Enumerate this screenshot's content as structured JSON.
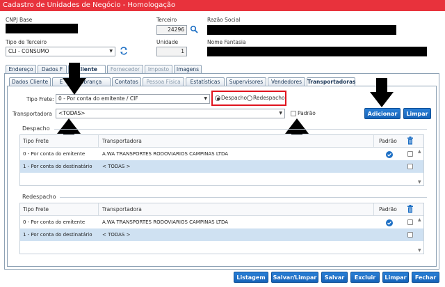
{
  "window": {
    "title": "Cadastro de Unidades de Negócio  - Homologação"
  },
  "header": {
    "cnpj_label": "CNPJ Base",
    "terceiro_label": "Terceiro",
    "terceiro_value": "24296",
    "razao_label": "Razão Social",
    "tipo_terceiro_label": "Tipo de Terceiro",
    "tipo_terceiro_value": "CLI - CONSUMO",
    "unidade_label": "Unidade",
    "unidade_value": "1",
    "fantasia_label": "Nome Fantasia"
  },
  "main_tabs": [
    {
      "label": "Endereço",
      "state": "normal"
    },
    {
      "label": "Dados F",
      "state": "normal"
    },
    {
      "label": "Cliente",
      "state": "active"
    },
    {
      "label": "Fornecedor",
      "state": "disabled"
    },
    {
      "label": "Imposto",
      "state": "disabled"
    },
    {
      "label": "Imagens",
      "state": "normal"
    }
  ],
  "sub_tabs": [
    {
      "label": "Dados Cliente",
      "state": "normal"
    },
    {
      "label": "E",
      "state": "normal"
    },
    {
      "label": "obrança",
      "state": "normal"
    },
    {
      "label": "Contatos",
      "state": "normal"
    },
    {
      "label": "Pessoa Física",
      "state": "disabled"
    },
    {
      "label": "Estatísticas",
      "state": "normal"
    },
    {
      "label": "Supervisores",
      "state": "normal"
    },
    {
      "label": "Vendedores",
      "state": "normal"
    },
    {
      "label": "Transportadoras",
      "state": "active"
    }
  ],
  "form": {
    "tipo_frete_label": "Tipo Frete:",
    "tipo_frete_value": "0 - Por conta do emitente / CIF",
    "radio_despacho": "Despacho",
    "radio_redespacho": "Redespacho",
    "radio_selected": "Despacho",
    "transportadora_label": "Transportadora",
    "transportadora_value": "<TODAS>",
    "padrao_label": "Padrão",
    "adicionar": "Adicionar",
    "limpar": "Limpar"
  },
  "despacho": {
    "title": "Despacho",
    "columns": {
      "tipo": "Tipo Frete",
      "transportadora": "Transportadora",
      "padrao": "Padrão"
    },
    "rows": [
      {
        "tipo": "0 - Por conta do emitente",
        "transportadora": "A.WA TRANSPORTES RODOVIARIOS CAMPINAS LTDA",
        "padrao": true,
        "selected": false
      },
      {
        "tipo": "1 - Por conta do destinatário",
        "transportadora": "< TODAS >",
        "padrao": false,
        "selected": true
      }
    ]
  },
  "redespacho": {
    "title": "Redespacho",
    "columns": {
      "tipo": "Tipo Frete",
      "transportadora": "Transportadora",
      "padrao": "Padrão"
    },
    "rows": [
      {
        "tipo": "0 - Por conta do emitente",
        "transportadora": "A.WA TRANSPORTES RODOVIARIOS CAMPINAS LTDA",
        "padrao": true,
        "selected": false
      },
      {
        "tipo": "1 - Por conta do destinatário",
        "transportadora": "< TODAS >",
        "padrao": false,
        "selected": true
      }
    ]
  },
  "footer": {
    "listagem": "Listagem",
    "salvar_limpar": "Salvar/Limpar",
    "salvar": "Salvar",
    "excluir": "Excluir",
    "limpar": "Limpar",
    "fechar": "Fechar"
  },
  "colors": {
    "title_bar": "#e8323c",
    "button": "#1a6fc7",
    "selected_row": "#cfe1f2",
    "highlight_box": "#e0141e"
  }
}
